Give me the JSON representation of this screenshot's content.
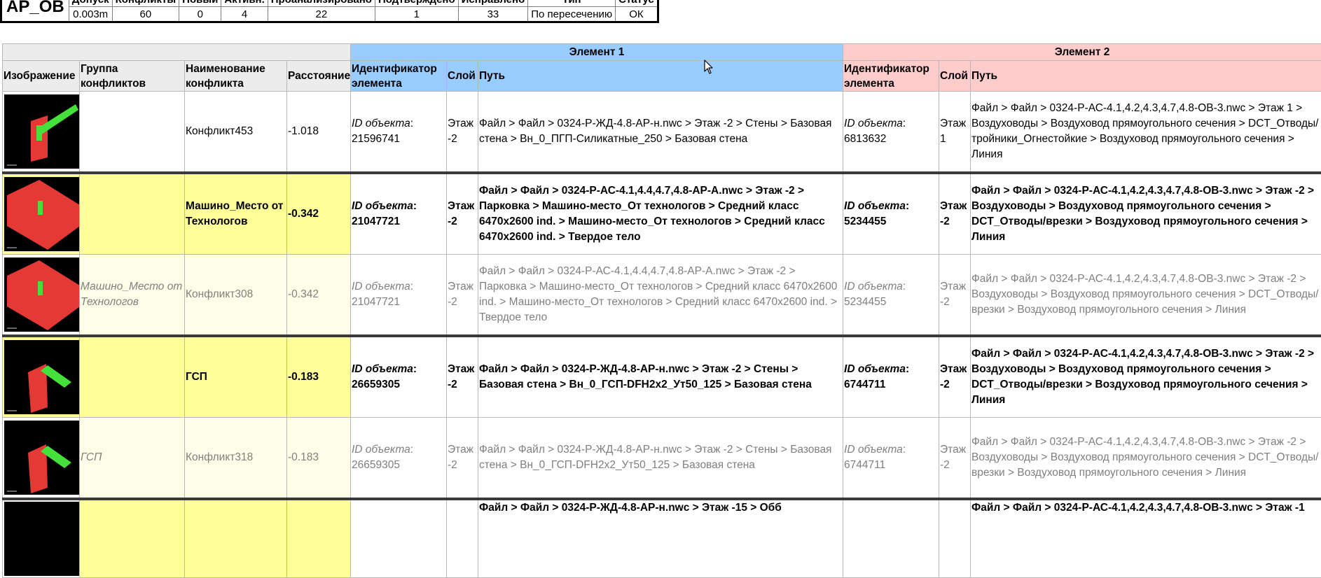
{
  "summary": {
    "name": "АР_ОВ",
    "headers": [
      "Допуск",
      "Конфликты",
      "Новый",
      "Активн.",
      "Проанализировано",
      "Подтверждено",
      "Исправлено",
      "Тип",
      "Статус"
    ],
    "values": [
      "0.003m",
      "60",
      "0",
      "4",
      "22",
      "1",
      "33",
      "По пересечению",
      "ОК"
    ]
  },
  "main": {
    "group_headers": {
      "element1": "Элемент 1",
      "element2": "Элемент 2"
    },
    "columns": {
      "image": "Изображение",
      "group": "Группа конфликтов",
      "name": "Наименование конфликта",
      "distance": "Расстояние",
      "id1": "Идентификатор элемента",
      "layer1": "Слой",
      "path1": "Путь",
      "id2": "Идентификатор элемента",
      "layer2": "Слой",
      "path2": "Путь"
    },
    "id_label": "ID объекта",
    "rows": [
      {
        "group": "",
        "name": "Конфликт453",
        "distance": "-1.018",
        "id1": "21596741",
        "layer1": "Этаж -2",
        "path1": "Файл > Файл > 0324-Р-ЖД-4.8-АР-н.nwc > Этаж -2 > Стены > Базовая стена > Вн_0_ПГП-Силикатные_250 > Базовая стена",
        "id2": "6813632",
        "layer2": "Этаж 1",
        "path2": "Файл > Файл > 0324-Р-АС-4.1,4.2,4.3,4.7,4.8-ОВ-3.nwc > Этаж 1 > Воздуховоды > Воздуховод прямоугольного сечения > DCT_Отводы/тройники_Огнестойкие > Воздуховод прямоугольного сечения > Линия"
      },
      {
        "group": "",
        "name": "Машино_Место от Технологов",
        "distance": "-0.342",
        "id1": "21047721",
        "layer1": "Этаж -2",
        "path1": "Файл > Файл > 0324-Р-АС-4.1,4.4,4.7,4.8-АР-А.nwc > Этаж -2 > Парковка > Машино-место_От технологов > Средний класс 6470x2600 ind. > Машино-место_От технологов > Средний класс 6470x2600 ind. > Твердое тело",
        "id2": "5234455",
        "layer2": "Этаж -2",
        "path2": "Файл > Файл > 0324-Р-АС-4.1,4.2,4.3,4.7,4.8-ОВ-3.nwc > Этаж -2 > Воздуховоды > Воздуховод прямоугольного сечения > DCT_Отводы/врезки > Воздуховод прямоугольного сечения > Линия"
      },
      {
        "group": "Машино_Место от Технологов",
        "name": "Конфликт308",
        "distance": "-0.342",
        "id1": "21047721",
        "layer1": "Этаж -2",
        "path1": "Файл > Файл > 0324-Р-АС-4.1,4.4,4.7,4.8-АР-А.nwc > Этаж -2 > Парковка > Машино-место_От технологов > Средний класс 6470x2600 ind. > Машино-место_От технологов > Средний класс 6470x2600 ind. > Твердое тело",
        "id2": "5234455",
        "layer2": "Этаж -2",
        "path2": "Файл > Файл > 0324-Р-АС-4.1,4.2,4.3,4.7,4.8-ОВ-3.nwc > Этаж -2 > Воздуховоды > Воздуховод прямоугольного сечения > DCT_Отводы/врезки > Воздуховод прямоугольного сечения > Линия"
      },
      {
        "group": "",
        "name": "ГСП",
        "distance": "-0.183",
        "id1": "26659305",
        "layer1": "Этаж -2",
        "path1": "Файл > Файл > 0324-Р-ЖД-4.8-АР-н.nwc > Этаж -2 > Стены > Базовая стена > Вн_0_ГСП-DFH2x2_Ут50_125 > Базовая стена",
        "id2": "6744711",
        "layer2": "Этаж -2",
        "path2": "Файл > Файл > 0324-Р-АС-4.1,4.2,4.3,4.7,4.8-ОВ-3.nwc > Этаж -2 > Воздуховоды > Воздуховод прямоугольного сечения > DCT_Отводы/врезки > Воздуховод прямоугольного сечения > Линия"
      },
      {
        "group": "ГСП",
        "name": "Конфликт318",
        "distance": "-0.183",
        "id1": "26659305",
        "layer1": "Этаж -2",
        "path1": "Файл > Файл > 0324-Р-ЖД-4.8-АР-н.nwc > Этаж -2 > Стены > Базовая стена > Вн_0_ГСП-DFH2x2_Ут50_125 > Базовая стена",
        "id2": "6744711",
        "layer2": "Этаж -2",
        "path2": "Файл > Файл > 0324-Р-АС-4.1,4.2,4.3,4.7,4.8-ОВ-3.nwc > Этаж -2 > Воздуховоды > Воздуховод прямоугольного сечения > DCT_Отводы/врезки > Воздуховод прямоугольного сечения > Линия"
      }
    ],
    "partial_row": {
      "path1": "Файл > Файл > 0324-Р-ЖД-4.8-АР-н.nwc > Этаж -15 > Обб",
      "path2": "Файл > Файл > 0324-Р-АС-4.1,4.2,4.3,4.7,4.8-ОВ-3.nwc > Этаж -1"
    }
  }
}
